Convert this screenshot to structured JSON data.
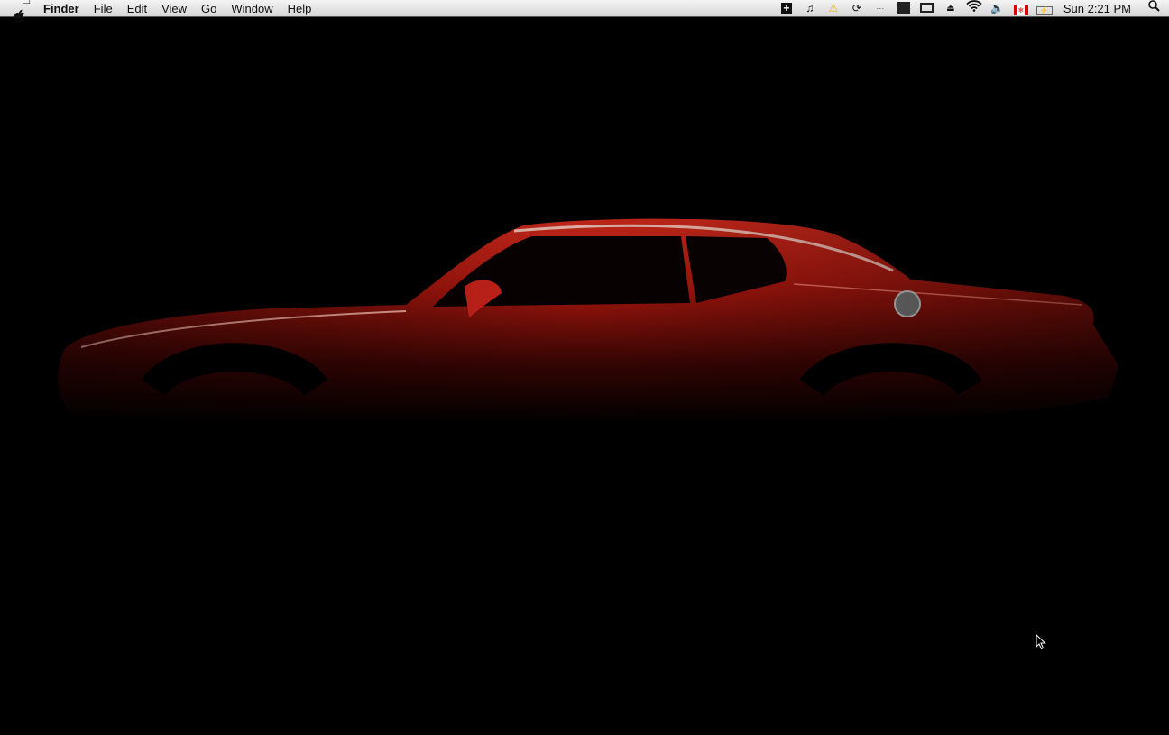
{
  "menubar": {
    "apple_icon": "apple-logo-icon",
    "app_name": "Finder",
    "menus": [
      "File",
      "Edit",
      "View",
      "Go",
      "Window",
      "Help"
    ],
    "status_icons": [
      "add-icon",
      "itunes-note-icon",
      "warning-icon",
      "time-machine-icon",
      "dots-icon",
      "spaces-icon",
      "display-icon",
      "eject-icon",
      "wifi-icon",
      "volume-icon",
      "canada-flag-input-icon",
      "battery-icon"
    ],
    "clock": "Sun 2:21 PM",
    "spotlight_icon": "spotlight-search-icon"
  },
  "desktop": {
    "wallpaper_accent": "#c81e14"
  }
}
